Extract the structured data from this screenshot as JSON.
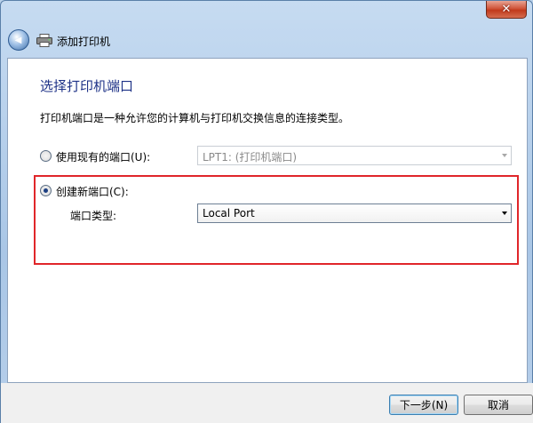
{
  "window": {
    "title": "添加打印机",
    "close_glyph": "✕",
    "back_glyph": "◀"
  },
  "page": {
    "heading": "选择打印机端口",
    "description": "打印机端口是一种允许您的计算机与打印机交换信息的连接类型。"
  },
  "options": {
    "existing_port": {
      "label": "使用现有的端口(U):",
      "selected": false,
      "value": "LPT1: (打印机端口)"
    },
    "new_port": {
      "label": "创建新端口(C):",
      "selected": true,
      "port_type_label": "端口类型:",
      "port_type_value": "Local Port"
    }
  },
  "buttons": {
    "next": "下一步(N)",
    "cancel": "取消"
  },
  "colors": {
    "heading": "#1e3287",
    "highlight": "#e0262a"
  },
  "icons": {
    "back": "back-arrow-icon",
    "printer": "printer-icon",
    "close": "close-icon"
  }
}
